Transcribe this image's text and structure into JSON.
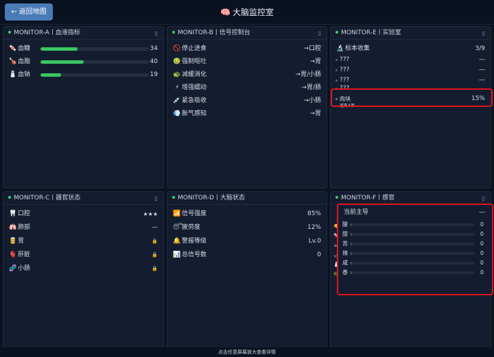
{
  "header": {
    "back_label": "← 返回地图",
    "title_icon": "🧠",
    "title": "大脑监控室"
  },
  "panels": {
    "a": {
      "title": "MONITOR-A丨血液指标",
      "more": "▯",
      "items": [
        {
          "icon": "🍬",
          "label": "血糖",
          "value": "34",
          "level": 0.34
        },
        {
          "icon": "🍗",
          "label": "血脂",
          "value": "40",
          "level": 0.4
        },
        {
          "icon": "🧂",
          "label": "血钠",
          "value": "19",
          "level": 0.19
        }
      ]
    },
    "b": {
      "title": "MONITOR-B丨信号控制台",
      "more": "▯",
      "items": [
        {
          "icon": "🚫",
          "label": "停止进食",
          "value": "→口腔"
        },
        {
          "icon": "🤢",
          "label": "强制呕吐",
          "value": "→胃"
        },
        {
          "icon": "🐢",
          "label": "减缓消化",
          "value": "→胃/小肠"
        },
        {
          "icon": "⚡",
          "label": "增强蠕动",
          "value": "→胃/肠"
        },
        {
          "icon": "💉",
          "label": "紧急吸收",
          "value": "→小肠"
        },
        {
          "icon": "💨",
          "label": "胀气感知",
          "value": "→胃"
        }
      ]
    },
    "e": {
      "title": "MONITOR-E丨实验室",
      "more": "▯",
      "collect_icon": "🔬",
      "collect_label": "标本收集",
      "collect_value": "3/9",
      "items": [
        {
          "label": "???",
          "value": "—"
        },
        {
          "label": "???",
          "value": "—"
        },
        {
          "label": "???",
          "value": "—"
        },
        {
          "label": "???",
          "value": ""
        }
      ],
      "highlight": {
        "label": "肉块",
        "value": "15%"
      },
      "note": "还有4项"
    },
    "c": {
      "title": "MONITOR-C丨器官状态",
      "more": "▯",
      "items": [
        {
          "icon": "🦷",
          "label": "口腔",
          "value": "★★★"
        },
        {
          "icon": "🫁",
          "label": "肺部",
          "value": "—"
        },
        {
          "icon": "🥫",
          "label": "胃",
          "value": "🔒"
        },
        {
          "icon": "🫀",
          "label": "肝脏",
          "value": "🔒"
        },
        {
          "icon": "🧬",
          "label": "小肠",
          "value": "🔒"
        }
      ]
    },
    "d": {
      "title": "MONITOR-D丨大脑状态",
      "more": "",
      "items": [
        {
          "icon": "📶",
          "label": "信号强度",
          "value": "85%"
        },
        {
          "icon": "😴",
          "label": "疲劳度",
          "value": "12%"
        },
        {
          "icon": "🔔",
          "label": "警报等级",
          "value": "Lv.0"
        },
        {
          "icon": "📊",
          "label": "总信号数",
          "value": "0"
        }
      ]
    },
    "f": {
      "title": "MONITOR-F丨感官",
      "more": "▯",
      "dominant_label": "当前主导",
      "dominant_value": "—",
      "tastes": [
        {
          "label": "酸",
          "value": "0"
        },
        {
          "label": "甜",
          "value": "0"
        },
        {
          "label": "苦",
          "value": "0"
        },
        {
          "label": "辣",
          "value": "0"
        },
        {
          "label": "咸",
          "value": "0"
        },
        {
          "label": "香",
          "value": "0"
        }
      ],
      "side_icons": [
        "🍋",
        "🍬",
        "☕",
        "🌶",
        "🧂",
        "🌿"
      ]
    }
  },
  "footer": {
    "hint": "点击任意屏幕放大查看详情"
  },
  "colors": {
    "accent": "#4a7bb7",
    "ok": "#3ac761",
    "alert": "#e3141b"
  }
}
